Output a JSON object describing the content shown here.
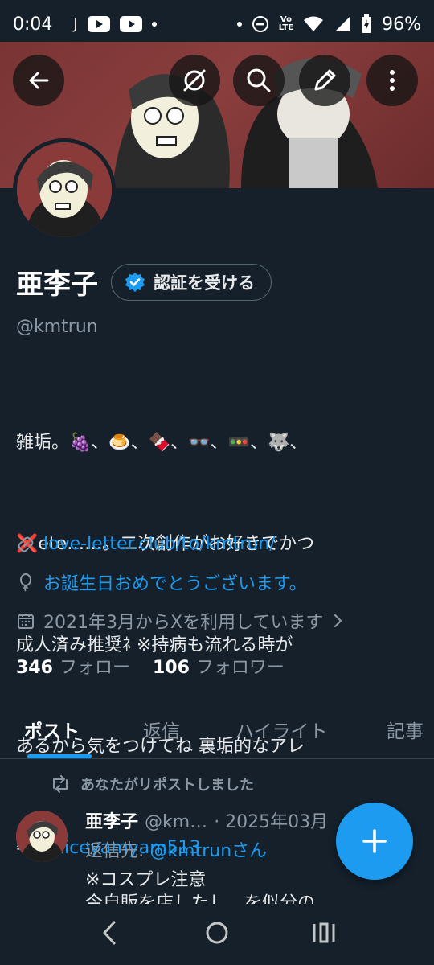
{
  "status_bar": {
    "time": "0:04",
    "carrier_letter": "J",
    "volte": "Vo\nLTE",
    "battery": "96%"
  },
  "header": {
    "icons": [
      "back-arrow-icon",
      "mute-icon",
      "search-icon",
      "edit-icon",
      "more-icon"
    ]
  },
  "profile": {
    "display_name": "亜李子",
    "verify_label": "認証を受ける",
    "handle": "@kmtrun",
    "bio_lines": [
      "雑垢。🍇、🍮、🍫、👓、🚥、🐺、",
      "❌ete……。二次創作がお好きでかつ",
      "成人済み推奨ﾈ ※持病も流れる時が",
      "あるから気をつけてね 裏垢的なアレ"
    ],
    "bio_arrow": "⇒",
    "bio_mention": "@aliceyamyam513",
    "link": "love-letter.club/to/kmtrun/",
    "birthday": "お誕生日おめでとうございます。",
    "joined": "2021年3月からXを利用しています",
    "following_count": "346",
    "following_label": "フォロー",
    "followers_count": "106",
    "followers_label": "フォロワー"
  },
  "tabs": [
    {
      "label": "ポスト",
      "active": true
    },
    {
      "label": "返信",
      "active": false
    },
    {
      "label": "ハイライト",
      "active": false
    },
    {
      "label": "記事",
      "active": false
    }
  ],
  "timeline": {
    "repost_label": "あなたがリポストしました",
    "post": {
      "name": "亜李子",
      "handle": "@km…",
      "date": "· 2025年03月",
      "reply_prefix": "返信先: ",
      "reply_mention": "@kmtrunさん",
      "text": "※コスプレ注意",
      "text_cut": "今自販を店したし…を似分の"
    }
  },
  "colors": {
    "background": "#15202b",
    "accent": "#1d9bf0",
    "muted": "#8b98a5"
  }
}
